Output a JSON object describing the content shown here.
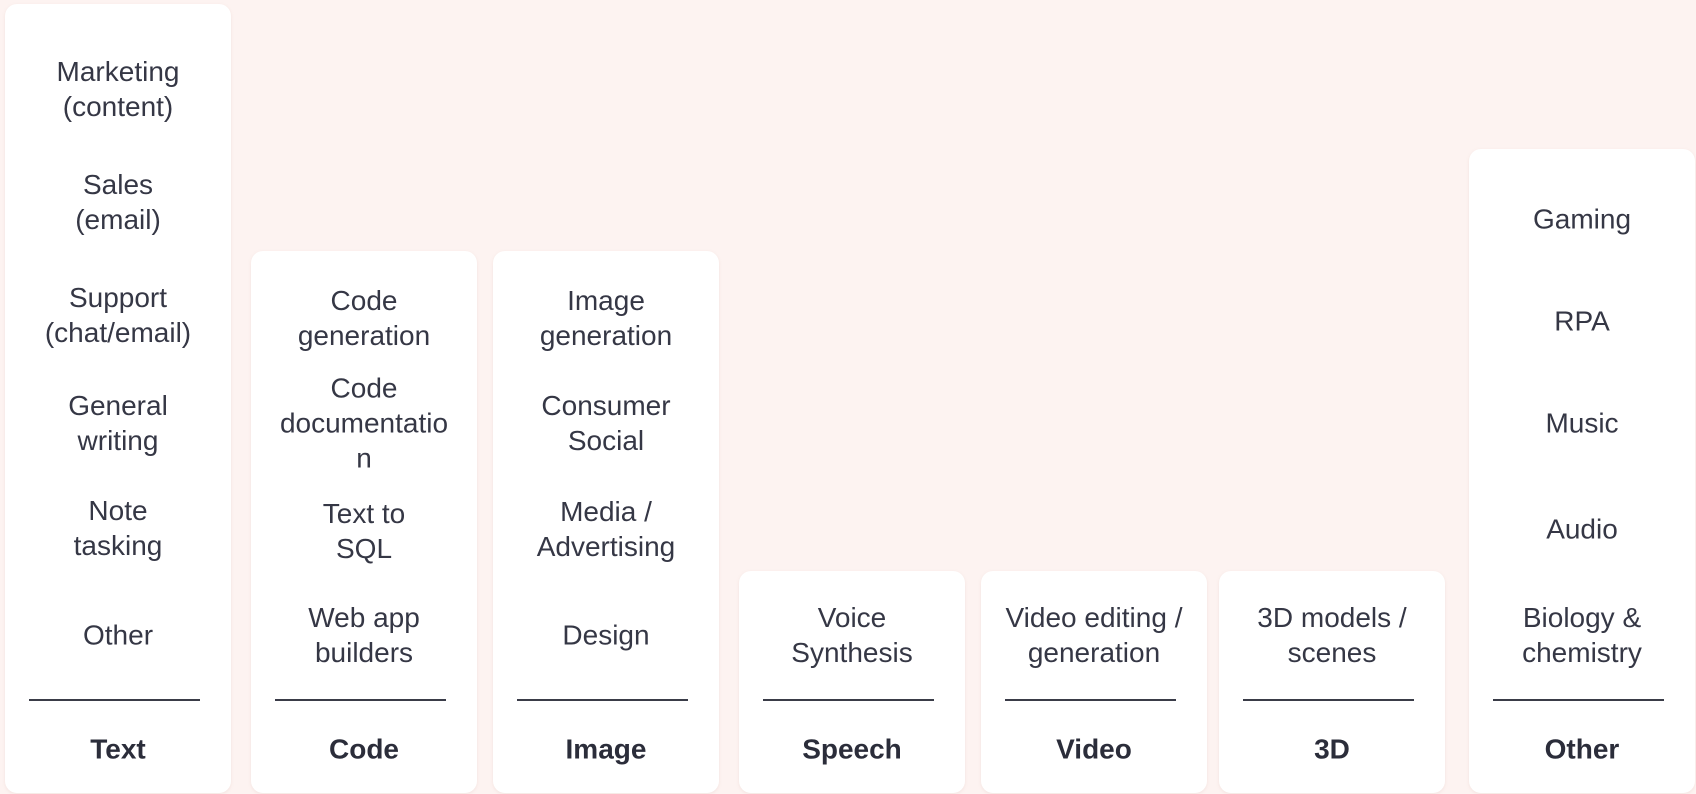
{
  "columns": [
    {
      "category": "Text",
      "items": [
        "Marketing\n(content)",
        "Sales\n(email)",
        "Support\n(chat/email)",
        "General\nwriting",
        "Note\ntasking",
        "Other"
      ]
    },
    {
      "category": "Code",
      "items": [
        "Code\ngeneration",
        "Code\ndocumentatio\nn",
        "Text to\nSQL",
        "Web app\nbuilders"
      ]
    },
    {
      "category": "Image",
      "items": [
        "Image\ngeneration",
        "Consumer\nSocial",
        "Media /\nAdvertising",
        "Design"
      ]
    },
    {
      "category": "Speech",
      "items": [
        "Voice\nSynthesis"
      ]
    },
    {
      "category": "Video",
      "items": [
        "Video editing /\ngeneration"
      ]
    },
    {
      "category": "3D",
      "items": [
        "3D models /\nscenes"
      ]
    },
    {
      "category": "Other",
      "items": [
        "Gaming",
        "RPA",
        "Music",
        "Audio",
        "Biology &\nchemistry"
      ]
    }
  ],
  "colors": {
    "background": "#fdf3f1",
    "card": "#ffffff",
    "text": "#353745",
    "divider": "#3a3c48"
  }
}
